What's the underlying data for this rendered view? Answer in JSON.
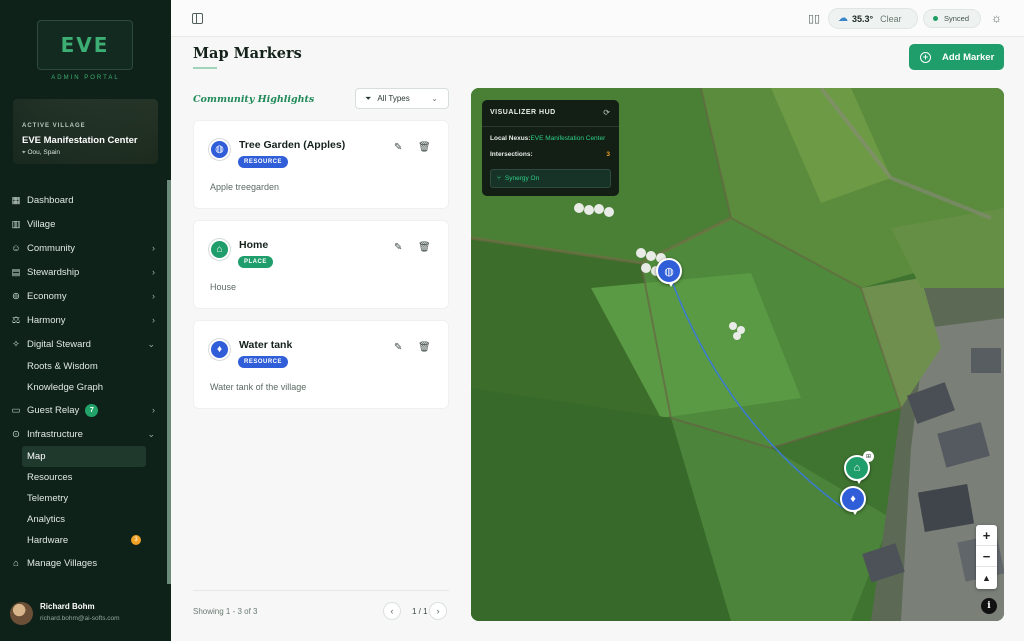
{
  "brand": {
    "logo_text": "EVE",
    "portal_label": "ADMIN PORTAL"
  },
  "village": {
    "label": "ACTIVE VILLAGE",
    "name": "EVE Manifestation Center",
    "location": "Oou, Spain"
  },
  "nav": {
    "dashboard": "Dashboard",
    "village": "Village",
    "community": "Community",
    "stewardship": "Stewardship",
    "economy": "Economy",
    "harmony": "Harmony",
    "digital_steward": "Digital Steward",
    "roots_wisdom": "Roots & Wisdom",
    "knowledge_graph": "Knowledge Graph",
    "guest_relay": "Guest Relay",
    "guest_relay_badge": "7",
    "infrastructure": "Infrastructure",
    "map": "Map",
    "resources": "Resources",
    "telemetry": "Telemetry",
    "analytics": "Analytics",
    "hardware": "Hardware",
    "hardware_badge": "3",
    "manage_villages": "Manage Villages"
  },
  "user": {
    "name": "Richard Bohm",
    "email": "richard.bohm@ai-softs.com"
  },
  "topbar": {
    "temperature": "35.3°",
    "condition": "Clear",
    "sync_status": "Synced"
  },
  "page": {
    "title": "Map Markers",
    "add_button": "Add Marker"
  },
  "list": {
    "section_title": "Community Highlights",
    "filter_label": "All Types",
    "showing": "Showing 1 - 3 of 3",
    "page_indicator": "1 / 1"
  },
  "markers": [
    {
      "title": "Tree Garden (Apples)",
      "tag": "RESOURCE",
      "description": "Apple treegarden",
      "icon": "apple-icon",
      "color": "#2f5ed8"
    },
    {
      "title": "Home",
      "tag": "PLACE",
      "description": "House",
      "icon": "home-icon",
      "color": "#1f9d6a"
    },
    {
      "title": "Water tank",
      "tag": "RESOURCE",
      "description": "Water tank of the village",
      "icon": "water-drop-icon",
      "color": "#2f5ed8"
    }
  ],
  "hud": {
    "title": "VISUALIZER HUD",
    "nexus_label": "Local Nexus:",
    "nexus_value": "EVE Manifestation Center",
    "intersections_label": "Intersections:",
    "intersections_value": "3",
    "synergy_button": "Synergy On"
  },
  "colors": {
    "accent": "#1f9d6a",
    "resource": "#2f5ed8",
    "place": "#1f9d6a",
    "sidebar": "#0f2219"
  }
}
